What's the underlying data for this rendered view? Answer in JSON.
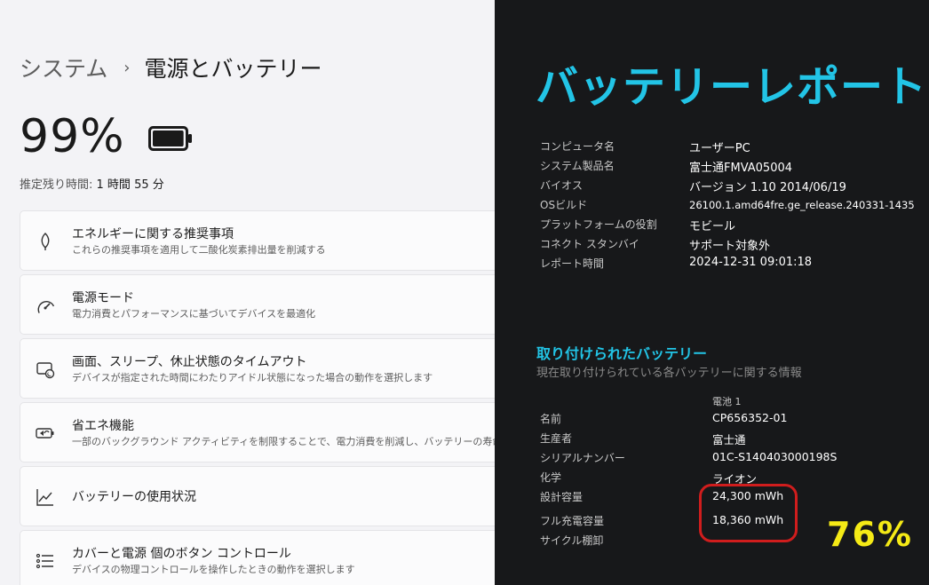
{
  "breadcrumb": {
    "parent": "システム",
    "separator": "›",
    "current": "電源とバッテリー"
  },
  "battery": {
    "percent": "99%",
    "remaining_label": "推定残り時間:",
    "remaining_value": "1 時間 55 分",
    "charge_level": 0.99
  },
  "cards": [
    {
      "icon": "leaf-icon",
      "title": "エネルギーに関する推奨事項",
      "subtitle": "これらの推奨事項を適用して二酸化炭素排出量を削減する"
    },
    {
      "icon": "speedometer-icon",
      "title": "電源モード",
      "subtitle": "電力消費とパフォーマンスに基づいてデバイスを最適化"
    },
    {
      "icon": "screen-sleep-icon",
      "title": "画面、スリープ、休止状態のタイムアウト",
      "subtitle": "デバイスが指定された時間にわたりアイドル状態になった場合の動作を選択します"
    },
    {
      "icon": "battery-saver-icon",
      "title": "省エネ機能",
      "subtitle": "一部のバックグラウンド アクティビティを制限することで、電力消費を削減し、バッテリーの寿命を延ばす"
    },
    {
      "icon": "usage-chart-icon",
      "title": "バッテリーの使用状況",
      "subtitle": ""
    },
    {
      "icon": "controls-list-icon",
      "title": "カバーと電源 個のボタン コントロール",
      "subtitle": "デバイスの物理コントロールを操作したときの動作を選択します"
    }
  ],
  "report": {
    "title": "バッテリーレポート",
    "info": [
      {
        "key": "コンピュータ名",
        "value": "ユーザーPC"
      },
      {
        "key": "システム製品名",
        "value": "富士通FMVA05004"
      },
      {
        "key": "バイオス",
        "value": "バージョン 1.10 2014/06/19"
      },
      {
        "key": "OSビルド",
        "value": "26100.1.amd64fre.ge_release.240331-1435"
      },
      {
        "key": "プラットフォームの役割",
        "value": "モビール"
      },
      {
        "key": "コネクト スタンバイ",
        "value": "サポート対象外"
      },
      {
        "key": "レポート時間",
        "value": "2024-12-31  09:01:18"
      }
    ],
    "installed_title": "取り付けられたバッテリー",
    "installed_subtitle": "現在取り付けられている各バッテリーに関する情報",
    "battery_column": "電池 1",
    "battery_rows": [
      {
        "key": "名前",
        "value": "CP656352-01"
      },
      {
        "key": "生産者",
        "value": "富士通"
      },
      {
        "key": "シリアルナンバー",
        "value": "01C-S140403000198S"
      },
      {
        "key": "化学",
        "value": "ライオン"
      },
      {
        "key": "設計容量",
        "value": "24,300 mWh"
      },
      {
        "key": "フル充電容量",
        "value": "18,360 mWh"
      },
      {
        "key": "サイクル棚卸",
        "value": ""
      }
    ],
    "health_percent": "76%"
  },
  "colors": {
    "accent_cyan": "#22c4e6",
    "highlight_red": "#d01d1d",
    "badge_yellow": "#f5ea16"
  }
}
